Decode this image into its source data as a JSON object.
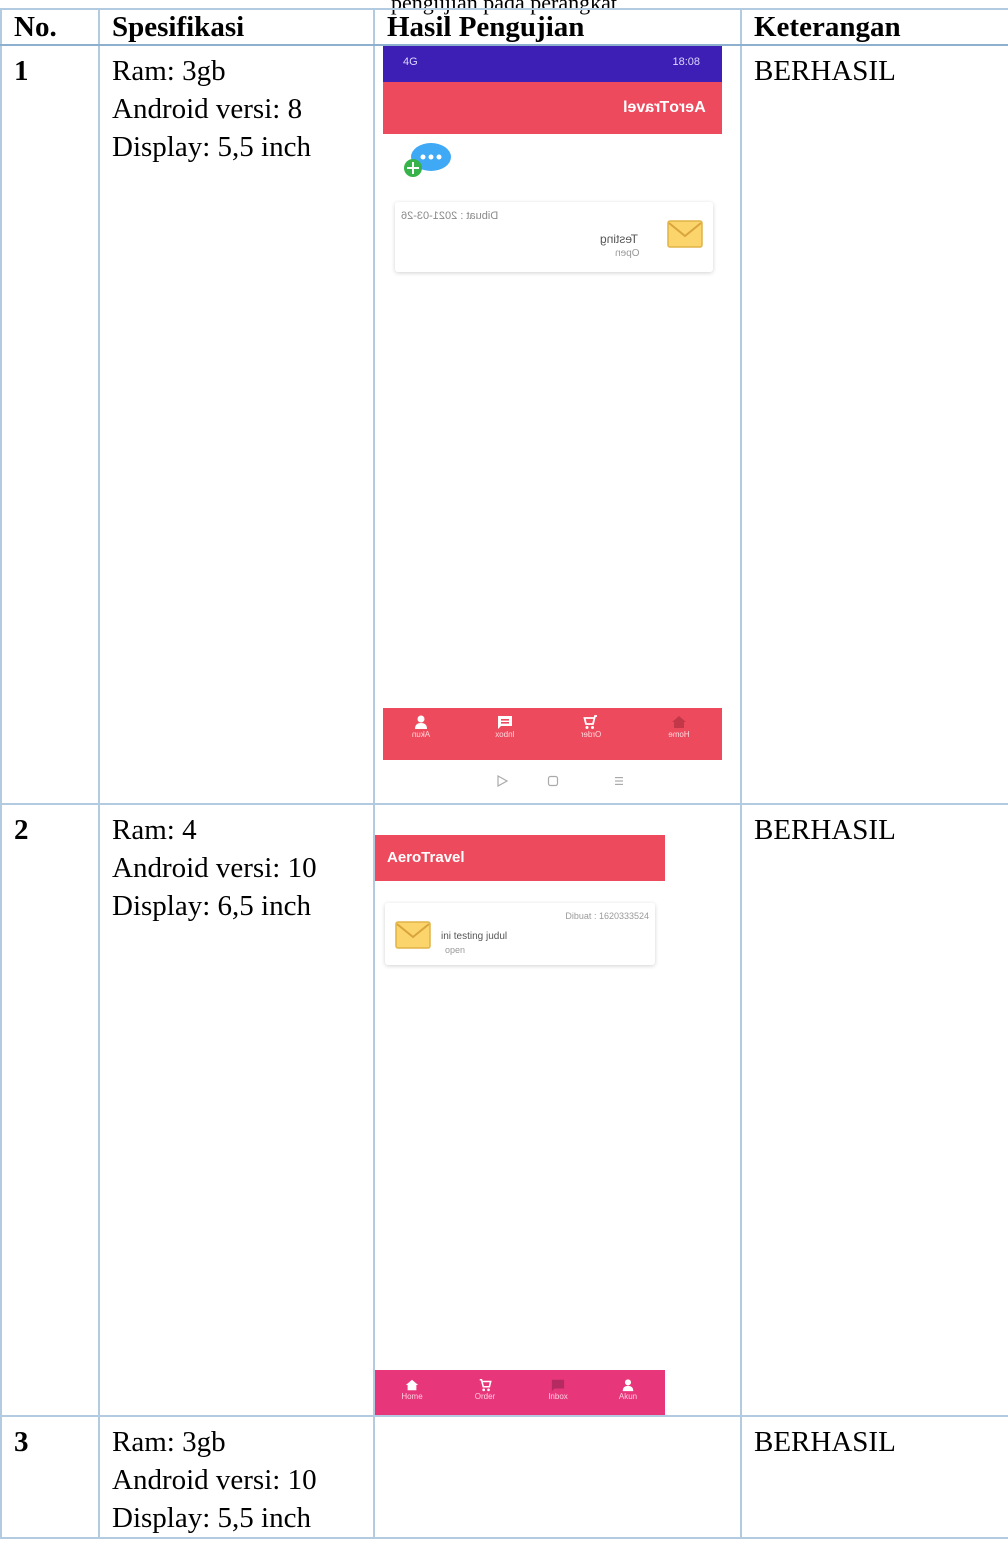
{
  "caption": "pengujian pada perangkat",
  "table": {
    "headers": {
      "no": "No.",
      "spesifikasi": "Spesifikasi",
      "hasil": "Hasil Pengujian",
      "keterangan": "Keterangan"
    },
    "rows": [
      {
        "no": "1",
        "spec": [
          "Ram: 3gb",
          "Android versi: 8",
          "Display: 5,5 inch"
        ],
        "keterangan": "BERHASIL"
      },
      {
        "no": "2",
        "spec": [
          "Ram: 4",
          "Android versi: 10",
          "Display: 6,5 inch"
        ],
        "keterangan": "BERHASIL"
      },
      {
        "no": "3",
        "spec": [
          "Ram: 3gb",
          "Android versi: 10",
          "Display: 5,5 inch"
        ],
        "keterangan": "BERHASIL"
      }
    ]
  },
  "phone1": {
    "status_left": "18:08",
    "status_right": "4G",
    "app_title": "AeroTravel",
    "message": {
      "title": "Testing",
      "subtitle": "Open",
      "date": "Dibuat : 2021-03-26"
    },
    "nav": [
      "Home",
      "Order",
      "Inbox",
      "Akun"
    ],
    "colors": {
      "status": "#3d1fb5",
      "accent": "#ee4a5d"
    }
  },
  "phone2": {
    "app_title": "AeroTravel",
    "message": {
      "title": "ini testing judul",
      "subtitle": "open",
      "date": "Dibuat : 1620333524"
    },
    "nav": [
      "Home",
      "Order",
      "Inbox",
      "Akun"
    ],
    "colors": {
      "accent": "#ee4a5d",
      "nav": "#e8367b"
    }
  }
}
